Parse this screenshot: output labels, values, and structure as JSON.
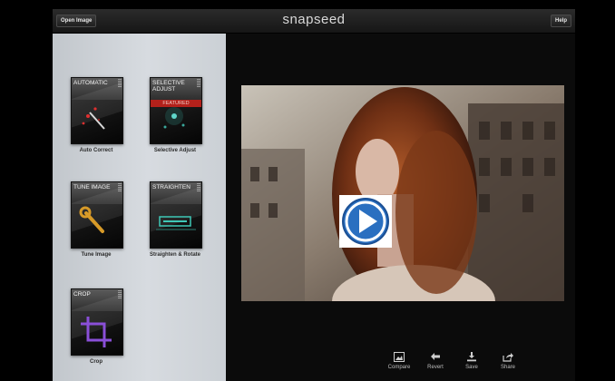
{
  "topbar": {
    "open_label": "Open Image",
    "logo": "snapseed",
    "help_label": "Help"
  },
  "tools": [
    {
      "title": "AUTOMATIC",
      "label": "Auto Correct",
      "icon": "wand-icon"
    },
    {
      "title": "SELECTIVE ADJUST",
      "label": "Selective Adjust",
      "badge": "FEATURED",
      "icon": "control-point-icon"
    },
    {
      "title": "TUNE IMAGE",
      "label": "Tune Image",
      "icon": "wrench-icon"
    },
    {
      "title": "STRAIGHTEN",
      "label": "Straighten & Rotate",
      "icon": "straighten-icon"
    },
    {
      "title": "CROP",
      "label": "Crop",
      "icon": "crop-icon"
    }
  ],
  "bottom_toolbar": [
    {
      "label": "Compare",
      "icon": "image-icon"
    },
    {
      "label": "Revert",
      "icon": "revert-arrow-icon"
    },
    {
      "label": "Save",
      "icon": "download-icon"
    },
    {
      "label": "Share",
      "icon": "share-icon"
    }
  ],
  "colors": {
    "featured_badge": "#b3211b",
    "play_button": "#2a6fc0",
    "sidebar_bg": "#d7dbe0"
  }
}
